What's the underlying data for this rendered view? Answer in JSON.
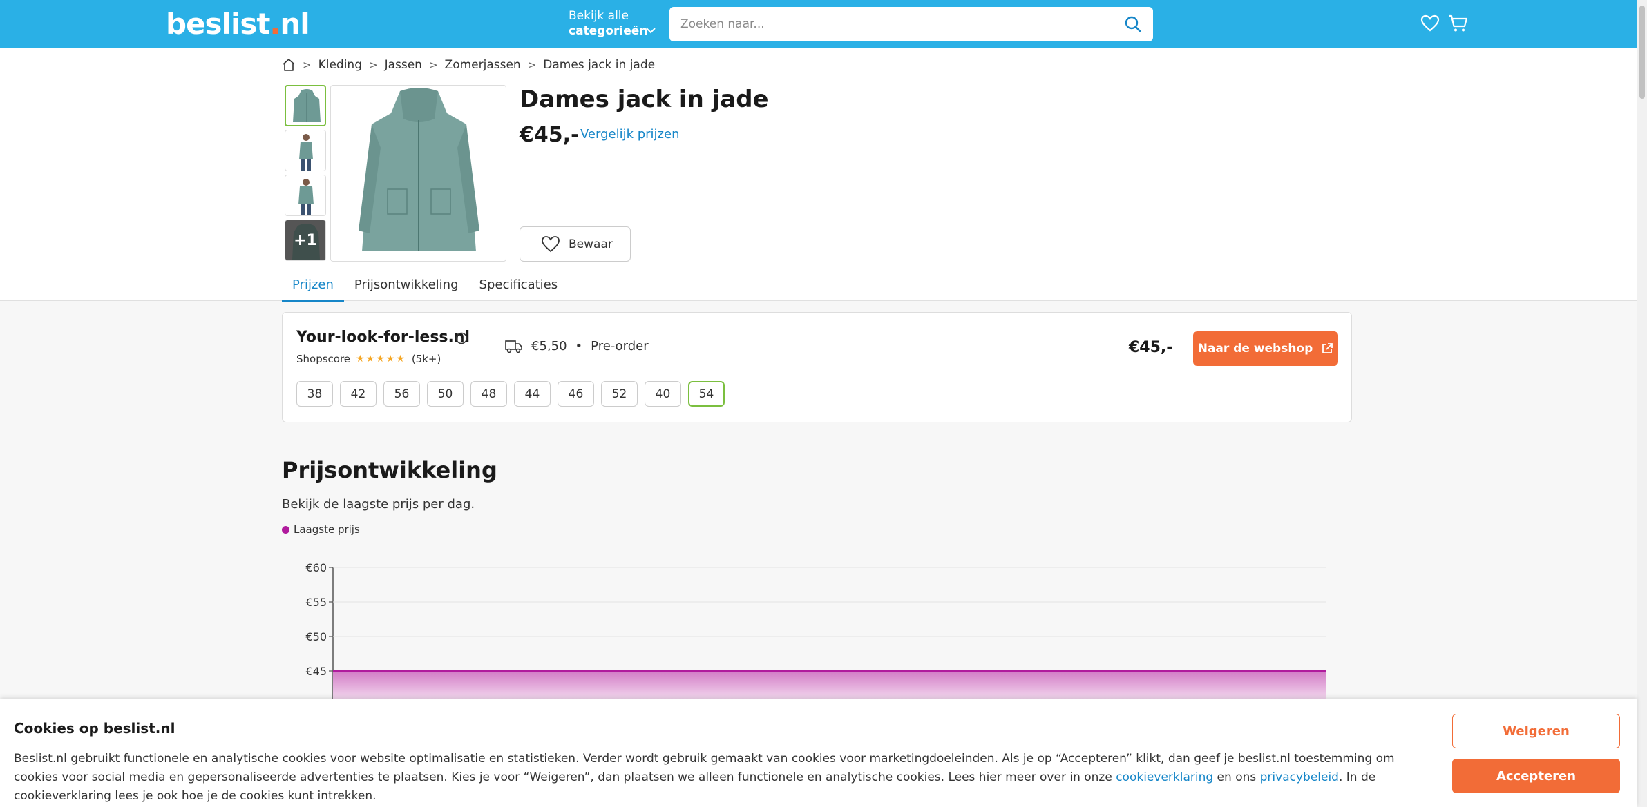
{
  "header": {
    "logo_main": "beslist",
    "logo_dot": ".",
    "logo_tld": "nl",
    "categories_line1": "Bekijk alle",
    "categories_line2": "categorieën",
    "search_placeholder": "Zoeken naar..."
  },
  "breadcrumb": [
    "Kleding",
    "Jassen",
    "Zomerjassen",
    "Dames jack in jade"
  ],
  "product": {
    "title": "Dames jack in jade",
    "price": "€45,-",
    "compare_label": "Vergelijk prijzen",
    "save_label": "Bewaar",
    "more_images": "+1"
  },
  "tabs": [
    "Prijzen",
    "Prijsontwikkeling",
    "Specificaties"
  ],
  "offer": {
    "shop": "Your-look-for-less.nl",
    "shopscore_label": "Shopscore",
    "rating": 4.5,
    "stars": "★★★★★",
    "reviews": "(5k+)",
    "shipping": "€5,50",
    "bullet": "•",
    "availability": "Pre-order",
    "price": "€45,-",
    "cta": "Naar de webshop",
    "sizes": [
      "38",
      "42",
      "56",
      "50",
      "48",
      "44",
      "46",
      "52",
      "40",
      "54"
    ],
    "selected_size": "54"
  },
  "price_history": {
    "title": "Prijsontwikkeling",
    "subtitle": "Bekijk de laagste prijs per dag.",
    "legend": "Laagste prijs",
    "series_color": "#b01b9d"
  },
  "chart_data": {
    "type": "area",
    "ylim": [
      40,
      60
    ],
    "yticks": [
      "€60",
      "€55",
      "€50",
      "€45"
    ],
    "ytick_values": [
      60,
      55,
      50,
      45
    ],
    "series": [
      {
        "name": "Laagste prijs",
        "values": [
          45,
          45
        ]
      }
    ],
    "grid": true
  },
  "cookie": {
    "title": "Cookies op beslist.nl",
    "text_1": "Beslist.nl gebruikt functionele en analytische cookies voor website optimalisatie en statistieken. Verder wordt gebruik gemaakt van cookies voor marketingdoeleinden. Als je op “Accepteren” klikt, dan geef je beslist.nl toestemming om cookies voor social media en gepersonaliseerde advertenties te plaatsen. Kies je voor “Weigeren”, dan plaatsen we alleen functionele en analytische cookies. Lees hier meer over in onze ",
    "link_1": "cookieverklaring",
    "text_2": " en ons ",
    "link_2": "privacybeleid",
    "text_3": ". In de cookieverklaring lees je ook hoe je de cookies kunt intrekken.",
    "reject": "Weigeren",
    "accept": "Accepteren"
  },
  "colors": {
    "brand": "#2ab0e6",
    "accent": "#f26c37",
    "link": "#1686c8",
    "selected": "#7bbf3f"
  }
}
